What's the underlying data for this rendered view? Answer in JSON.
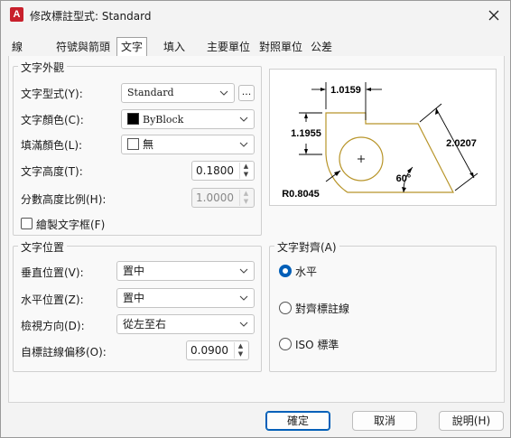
{
  "window": {
    "title": "修改標註型式: Standard",
    "app_icon_letter": "A"
  },
  "tabs": [
    "線",
    "符號與箭頭",
    "文字",
    "填入",
    "主要單位",
    "對照單位",
    "公差"
  ],
  "text_appearance": {
    "title": "文字外觀",
    "style_label": "文字型式(Y):",
    "style_value": "Standard",
    "style_more": "...",
    "color_label": "文字顏色(C):",
    "color_value": "ByBlock",
    "color_swatch": "#000000",
    "fill_label": "填滿顏色(L):",
    "fill_value": "無",
    "fill_swatch": "#ffffff",
    "height_label": "文字高度(T):",
    "height_value": "0.1800",
    "fraction_label": "分數高度比例(H):",
    "fraction_value": "1.0000",
    "frame_label": "繪製文字框(F)"
  },
  "text_placement": {
    "title": "文字位置",
    "vertical_label": "垂直位置(V):",
    "vertical_value": "置中",
    "horizontal_label": "水平位置(Z):",
    "horizontal_value": "置中",
    "view_dir_label": "檢視方向(D):",
    "view_dir_value": "從左至右",
    "offset_label": "自標註線偏移(O):",
    "offset_value": "0.0900"
  },
  "text_alignment": {
    "title": "文字對齊(A)",
    "options": [
      "水平",
      "對齊標註線",
      "ISO 標準"
    ]
  },
  "preview": {
    "dim_top": "1.0159",
    "dim_left": "1.1955",
    "dim_right": "2.0207",
    "angle": "60°",
    "radius": "R0.8045",
    "outline_color": "#b8952a"
  },
  "buttons": {
    "ok": "確定",
    "cancel": "取消",
    "help": "說明(H)"
  }
}
